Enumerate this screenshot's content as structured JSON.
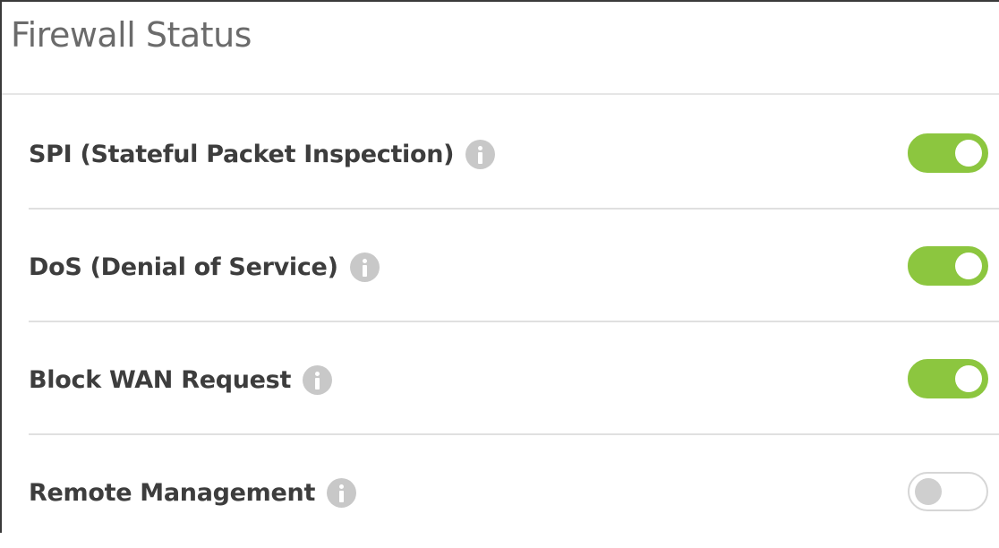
{
  "panel": {
    "title": "Firewall Status"
  },
  "settings": [
    {
      "label": "SPI (Stateful Packet Inspection)",
      "enabled": true
    },
    {
      "label": "DoS (Denial of Service)",
      "enabled": true
    },
    {
      "label": "Block WAN Request",
      "enabled": true
    },
    {
      "label": "Remote Management",
      "enabled": false
    }
  ],
  "icons": {
    "info": "info-icon"
  },
  "colors": {
    "toggle_on": "#8cc63f",
    "toggle_off_border": "#d6d6d6",
    "info_icon": "#c8c8c8",
    "label_text": "#3d3d3d",
    "title_text": "#6b6b6b"
  }
}
